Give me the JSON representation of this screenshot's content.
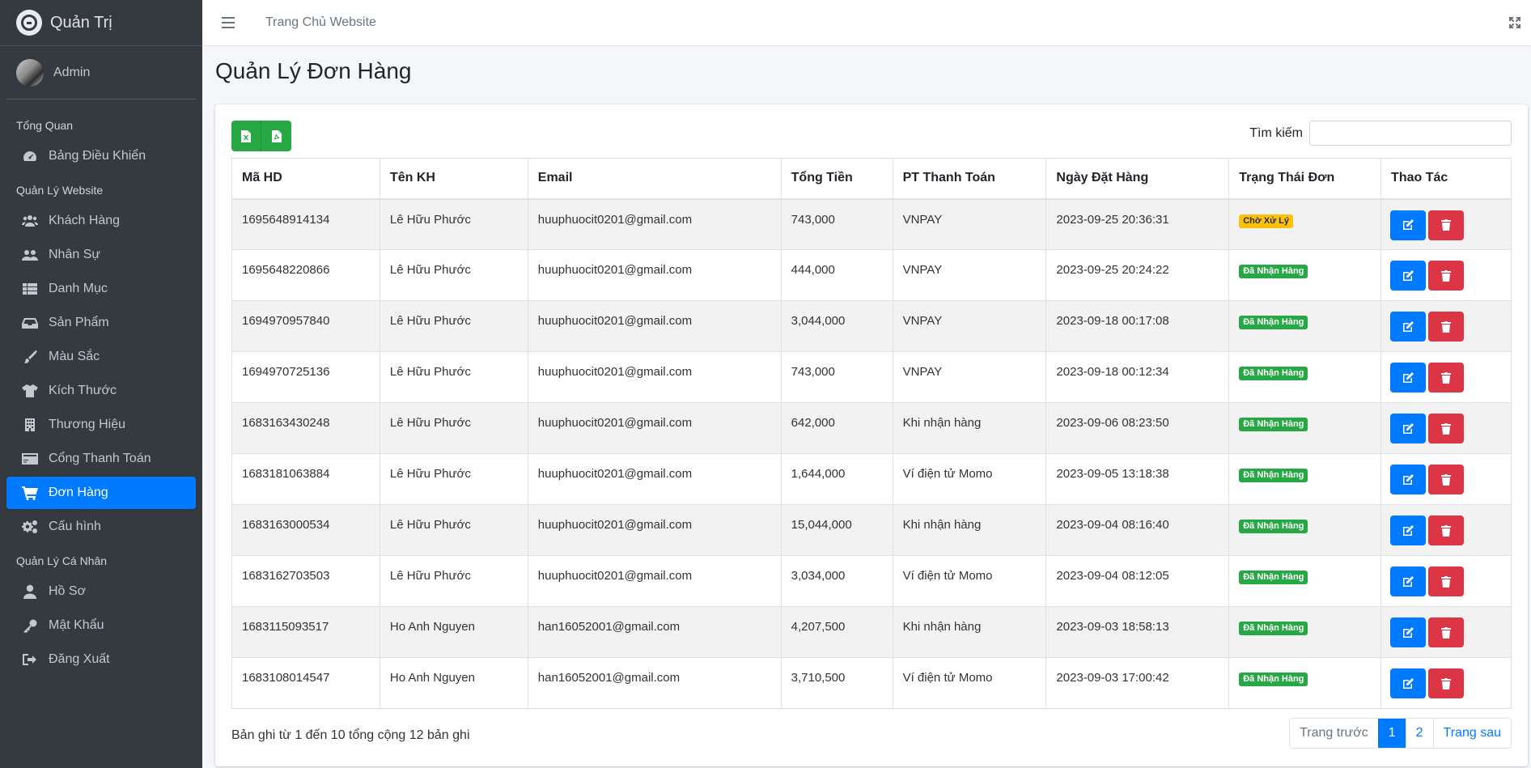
{
  "sidebar": {
    "brand": "Quản Trị",
    "user": "Admin",
    "sections": [
      {
        "header": "Tổng Quan",
        "items": [
          {
            "label": "Bảng Điều Khiển",
            "icon": "tachometer-icon",
            "active": false
          }
        ]
      },
      {
        "header": "Quản Lý Website",
        "items": [
          {
            "label": "Khách Hàng",
            "icon": "users-icon",
            "active": false
          },
          {
            "label": "Nhân Sự",
            "icon": "user-group-icon",
            "active": false
          },
          {
            "label": "Danh Mục",
            "icon": "list-icon",
            "active": false
          },
          {
            "label": "Sản Phẩm",
            "icon": "inbox-icon",
            "active": false
          },
          {
            "label": "Màu Sắc",
            "icon": "paint-brush-icon",
            "active": false
          },
          {
            "label": "Kích Thước",
            "icon": "tshirt-icon",
            "active": false
          },
          {
            "label": "Thương Hiệu",
            "icon": "building-icon",
            "active": false
          },
          {
            "label": "Cổng Thanh Toán",
            "icon": "credit-card-icon",
            "active": false
          },
          {
            "label": "Đơn Hàng",
            "icon": "cart-icon",
            "active": true
          },
          {
            "label": "Cấu hình",
            "icon": "cogs-icon",
            "active": false
          }
        ]
      },
      {
        "header": "Quản Lý Cá Nhân",
        "items": [
          {
            "label": "Hồ Sơ",
            "icon": "user-icon",
            "active": false
          },
          {
            "label": "Mật Khẩu",
            "icon": "key-icon",
            "active": false
          },
          {
            "label": "Đăng Xuất",
            "icon": "sign-out-icon",
            "active": false
          }
        ]
      }
    ]
  },
  "topbar": {
    "link": "Trang Chủ Website"
  },
  "page": {
    "title": "Quản Lý Đơn Hàng",
    "search_label": "Tìm kiếm",
    "search_value": "",
    "export_buttons": [
      "excel-icon",
      "pdf-icon"
    ]
  },
  "table": {
    "headers": [
      "Mã HD",
      "Tên KH",
      "Email",
      "Tổng Tiền",
      "PT Thanh Toán",
      "Ngày Đặt Hàng",
      "Trạng Thái Đơn",
      "Thao Tác"
    ],
    "rows": [
      {
        "id": "1695648914134",
        "name": "Lê Hữu Phước",
        "email": "huuphuocit0201@gmail.com",
        "total": "743,000",
        "payment": "VNPAY",
        "date": "2023-09-25 20:36:31",
        "status": "Chờ Xử Lý",
        "status_type": "warning"
      },
      {
        "id": "1695648220866",
        "name": "Lê Hữu Phước",
        "email": "huuphuocit0201@gmail.com",
        "total": "444,000",
        "payment": "VNPAY",
        "date": "2023-09-25 20:24:22",
        "status": "Đã Nhận Hàng",
        "status_type": "success"
      },
      {
        "id": "1694970957840",
        "name": "Lê Hữu Phước",
        "email": "huuphuocit0201@gmail.com",
        "total": "3,044,000",
        "payment": "VNPAY",
        "date": "2023-09-18 00:17:08",
        "status": "Đã Nhận Hàng",
        "status_type": "success"
      },
      {
        "id": "1694970725136",
        "name": "Lê Hữu Phước",
        "email": "huuphuocit0201@gmail.com",
        "total": "743,000",
        "payment": "VNPAY",
        "date": "2023-09-18 00:12:34",
        "status": "Đã Nhận Hàng",
        "status_type": "success"
      },
      {
        "id": "1683163430248",
        "name": "Lê Hữu Phước",
        "email": "huuphuocit0201@gmail.com",
        "total": "642,000",
        "payment": "Khi nhận hàng",
        "date": "2023-09-06 08:23:50",
        "status": "Đã Nhận Hàng",
        "status_type": "success"
      },
      {
        "id": "1683181063884",
        "name": "Lê Hữu Phước",
        "email": "huuphuocit0201@gmail.com",
        "total": "1,644,000",
        "payment": "Ví điện tử Momo",
        "date": "2023-09-05 13:18:38",
        "status": "Đã Nhận Hàng",
        "status_type": "success"
      },
      {
        "id": "1683163000534",
        "name": "Lê Hữu Phước",
        "email": "huuphuocit0201@gmail.com",
        "total": "15,044,000",
        "payment": "Khi nhận hàng",
        "date": "2023-09-04 08:16:40",
        "status": "Đã Nhận Hàng",
        "status_type": "success"
      },
      {
        "id": "1683162703503",
        "name": "Lê Hữu Phước",
        "email": "huuphuocit0201@gmail.com",
        "total": "3,034,000",
        "payment": "Ví điện tử Momo",
        "date": "2023-09-04 08:12:05",
        "status": "Đã Nhận Hàng",
        "status_type": "success"
      },
      {
        "id": "1683115093517",
        "name": "Ho Anh Nguyen",
        "email": "han16052001@gmail.com",
        "total": "4,207,500",
        "payment": "Khi nhận hàng",
        "date": "2023-09-03 18:58:13",
        "status": "Đã Nhận Hàng",
        "status_type": "success"
      },
      {
        "id": "1683108014547",
        "name": "Ho Anh Nguyen",
        "email": "han16052001@gmail.com",
        "total": "3,710,500",
        "payment": "Ví điện tử Momo",
        "date": "2023-09-03 17:00:42",
        "status": "Đã Nhận Hàng",
        "status_type": "success"
      }
    ]
  },
  "footer": {
    "info": "Bản ghi từ 1 đến 10 tổng cộng 12 bản ghi",
    "pagination": {
      "prev": "Trang trước",
      "pages": [
        "1",
        "2"
      ],
      "current": "1",
      "next": "Trang sau"
    }
  },
  "colors": {
    "primary": "#007bff",
    "success": "#28a745",
    "warning": "#ffc107",
    "danger": "#dc3545",
    "sidebar": "#343a40"
  }
}
